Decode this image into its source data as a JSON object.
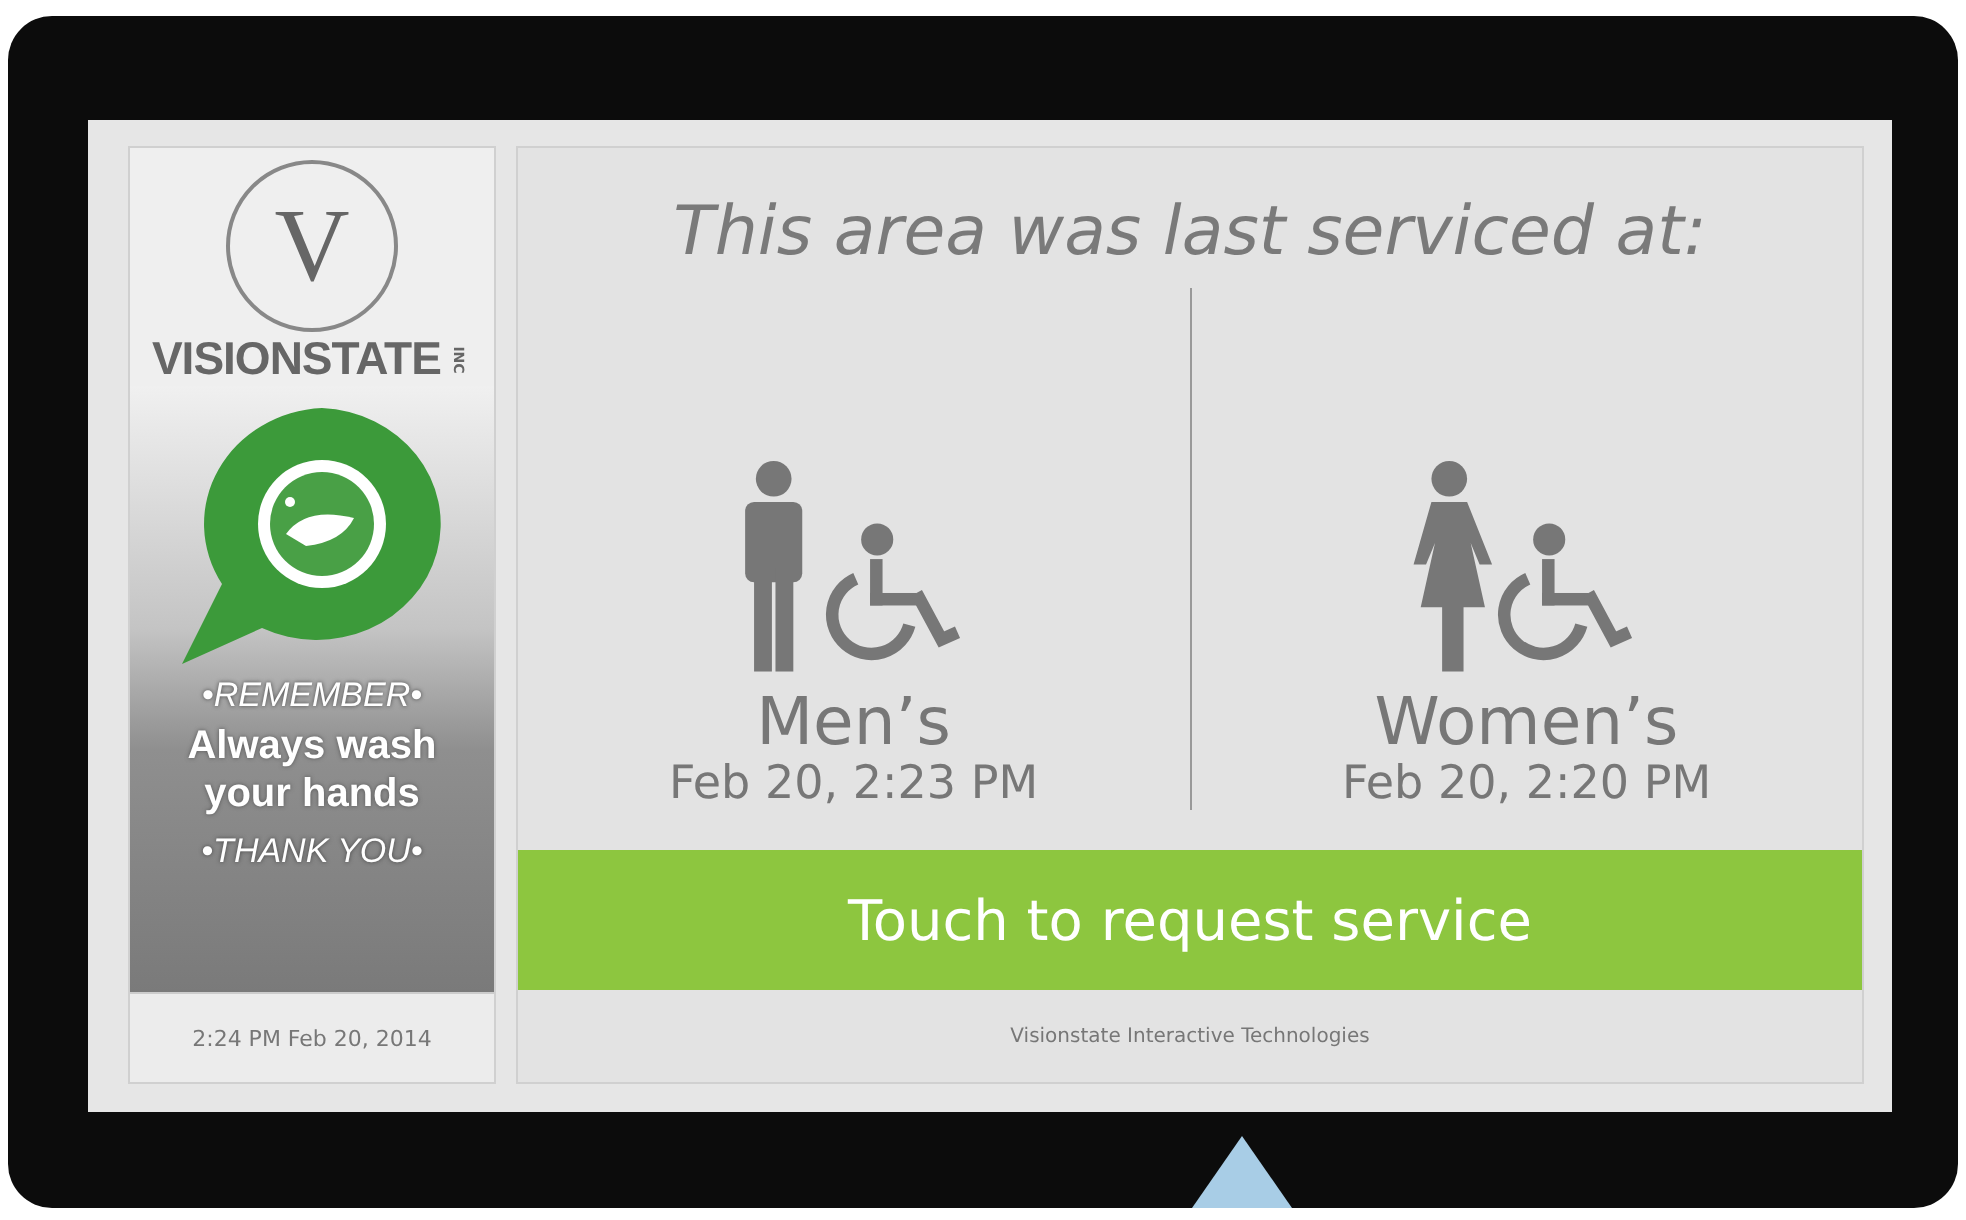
{
  "brand": {
    "logo_letter": "V",
    "name": "VISIONSTATE",
    "suffix": "INC"
  },
  "reminder": {
    "top": "•REMEMBER•",
    "message": "Always wash your hands",
    "bottom": "•THANK YOU•"
  },
  "clock": "2:24 PM Feb 20, 2014",
  "heading": "This area was last serviced at:",
  "restrooms": [
    {
      "kind": "men",
      "label": "Men’s",
      "time": "Feb 20, 2:23 PM"
    },
    {
      "kind": "women",
      "label": "Women’s",
      "time": "Feb 20, 2:20 PM"
    }
  ],
  "action": {
    "label": "Touch to request service"
  },
  "footer": "Visionstate Interactive Technologies"
}
